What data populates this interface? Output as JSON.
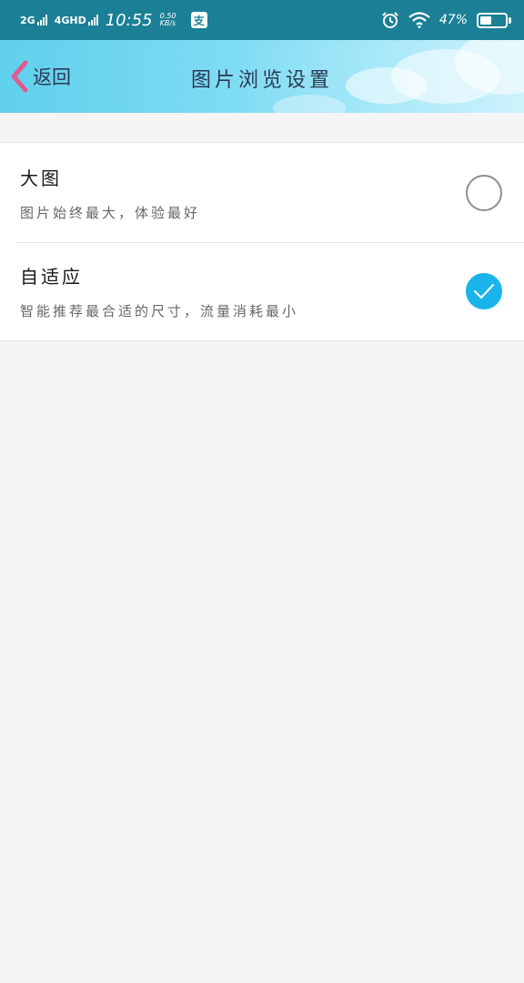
{
  "status_bar": {
    "network_1": "2G",
    "network_2": "4GHD",
    "time": "10:55",
    "speed_value": "0.50",
    "speed_unit": "KB/s",
    "pay_icon_label": "支",
    "battery_percent": "47%",
    "battery_level": 0.47
  },
  "title_bar": {
    "back_label": "返回",
    "title": "图片浏览设置",
    "accent_color": "#e25a8f"
  },
  "options": [
    {
      "title": "大图",
      "description": "图片始终最大，体验最好",
      "selected": false
    },
    {
      "title": "自适应",
      "description": "智能推荐最合适的尺寸，流量消耗最小",
      "selected": true
    }
  ],
  "colors": {
    "status_bar_bg": "#1b7f95",
    "check_color": "#18b4ea",
    "page_bg": "#f5f5f5"
  },
  "icons": [
    "signal-icon",
    "alarm-icon",
    "wifi-icon",
    "battery-icon",
    "back-chevron-icon",
    "radio-empty-icon",
    "checkmark-icon"
  ]
}
